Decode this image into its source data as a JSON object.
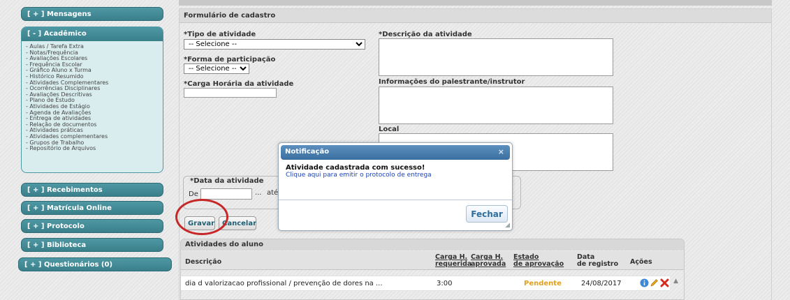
{
  "sidebar": {
    "mensagens": "[ + ] Mensagens",
    "academico": "[ - ] Acadêmico",
    "academico_items": [
      "- Aulas / Tarefa Extra",
      "- Notas/Frequência",
      "- Avaliações Escolares",
      "- Frequência Escolar",
      "- Gráfico Aluno x Turma",
      "- Histórico Resumido",
      "- Atividades Complementares",
      "- Ocorrências Disciplinares",
      "- Avaliações Descritivas",
      "- Plano de Estudo",
      "- Atividades de Estágio",
      "- Agenda de Avaliações",
      "- Entrega de atividades",
      "- Relação de documentos",
      "- Atividades práticas",
      "- Atividades complementares",
      "- Grupos de Trabalho",
      "- Repositório de Arquivos"
    ],
    "recebimentos": "[ + ] Recebimentos",
    "matricula": "[ + ] Matrícula Online",
    "protocolo": "[ + ] Protocolo",
    "biblioteca": "[ + ] Biblioteca",
    "questionarios": "[ + ] Questionários (0)"
  },
  "form": {
    "title": "Formulário de cadastro",
    "tipo_label": "*Tipo de atividade",
    "tipo_value": "-- Selecione --",
    "forma_label": "*Forma de participação",
    "forma_value": "-- Selecione --",
    "carga_label": "*Carga Horária da atividade",
    "descricao_label": "*Descrição da atividade",
    "palestrante_label": "Informações do palestrante/instrutor",
    "local_label": "Local",
    "data_legend": "*Data da atividade",
    "de_label": "De",
    "ellipsis": "...",
    "ate_label": "até",
    "gravar": "Gravar",
    "cancelar": "Cancelar"
  },
  "activities": {
    "title": "Atividades do aluno",
    "headers": {
      "descricao": "Descrição",
      "carga_req_1": "Carga H.",
      "carga_req_2": "requerida",
      "carga_apr_1": "Carga H.",
      "carga_apr_2": "aprovada",
      "estado_1": "Estado",
      "estado_2": "de aprovação",
      "data_1": "Data",
      "data_2": "de registro",
      "acoes": "Ações"
    },
    "rows": [
      {
        "descricao": "dia d valorizacao profissional / prevenção de dores na ...",
        "carga_requerida": "3:00",
        "carga_aprovada": "",
        "estado": "Pendente",
        "data": "24/08/2017"
      }
    ],
    "icons": [
      "info-icon",
      "edit-pencil-icon",
      "delete-x-icon"
    ]
  },
  "modal": {
    "title": "Notificação",
    "close": "×",
    "message": "Atividade cadastrada com sucesso!",
    "link": "Clique aqui para emitir o protocolo de entrega",
    "button": "Fechar"
  },
  "colors": {
    "sidebar_header": "#4e98a3",
    "modal_header": "#4a80b0",
    "pending": "#e0a020",
    "highlight_ring": "#c62828"
  }
}
